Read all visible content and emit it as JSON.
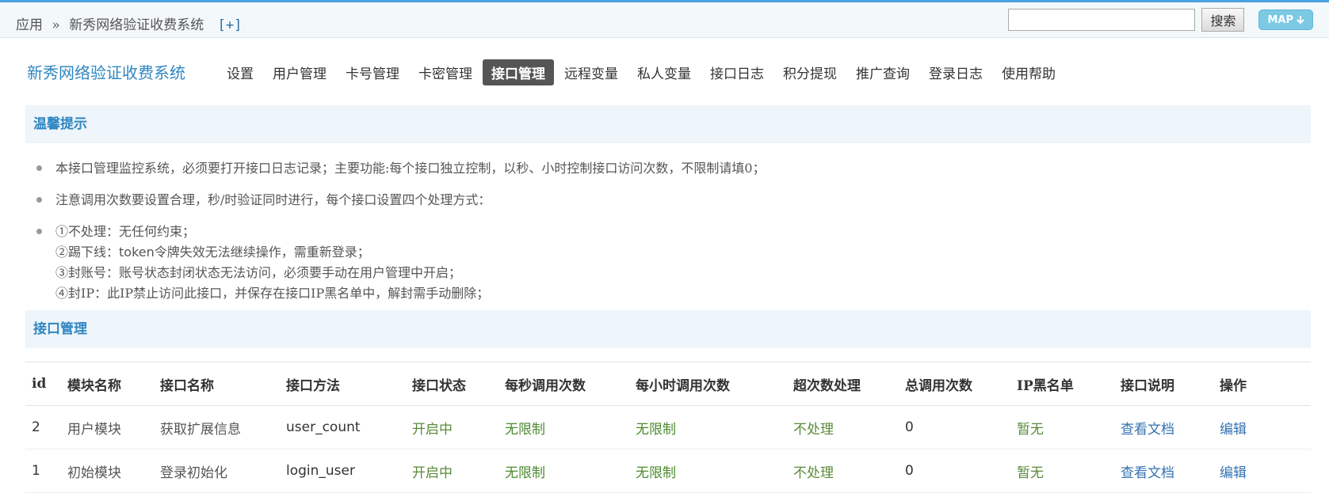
{
  "topbar": {
    "breadcrumb_app": "应用",
    "breadcrumb_sep": "»",
    "breadcrumb_system": "新秀网络验证收费系统",
    "breadcrumb_add": "[+]",
    "search_value": "",
    "search_button": "搜索",
    "map_button": "MAP"
  },
  "nav": {
    "brand": "新秀网络验证收费系统",
    "items": [
      "设置",
      "用户管理",
      "卡号管理",
      "卡密管理",
      "接口管理",
      "远程变量",
      "私人变量",
      "接口日志",
      "积分提现",
      "推广查询",
      "登录日志",
      "使用帮助"
    ],
    "active_index": 4
  },
  "tips": {
    "title": "温馨提示",
    "line1": "本接口管理监控系统，必须要打开接口日志记录；主要功能:每个接口独立控制，以秒、小时控制接口访问次数，不限制请填0；",
    "line2": "注意调用次数要设置合理，秒/时验证同时进行，每个接口设置四个处理方式：",
    "line3a": "①不处理：无任何约束；",
    "line3b_pre": "②踢下线：",
    "line3b_token": "token",
    "line3b_post": "令牌失效无法继续操作，需重新登录；",
    "line3c": "③封账号：账号状态封闭状态无法访问，必须要手动在用户管理中开启；",
    "line3d": "④封IP：此IP禁止访问此接口，并保存在接口IP黑名单中，解封需手动删除；"
  },
  "table": {
    "title": "接口管理",
    "headers": [
      "id",
      "模块名称",
      "接口名称",
      "接口方法",
      "接口状态",
      "每秒调用次数",
      "每小时调用次数",
      "超次数处理",
      "总调用次数",
      "IP黑名单",
      "接口说明",
      "操作"
    ],
    "rows": [
      [
        "2",
        "用户模块",
        "获取扩展信息",
        "user_count",
        "开启中",
        "无限制",
        "无限制",
        "不处理",
        "0",
        "暂无",
        "查看文档",
        "编辑"
      ],
      [
        "1",
        "初始模块",
        "登录初始化",
        "login_user",
        "开启中",
        "无限制",
        "无限制",
        "不处理",
        "0",
        "暂无",
        "查看文档",
        "编辑"
      ]
    ]
  },
  "colors": {
    "accent": "#2f86c2",
    "active_nav": "#555555",
    "status_green": "#5a8a3a",
    "link": "#3573b0"
  }
}
